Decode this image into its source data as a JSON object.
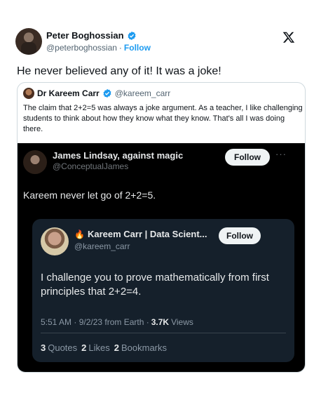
{
  "tweet": {
    "author_name": "Peter Boghossian",
    "author_handle": "@peterboghossian",
    "separator": "·",
    "follow_label": "Follow",
    "text": "He never believed any of it! It was a joke!"
  },
  "quote": {
    "author_name": "Dr Kareem Carr",
    "author_handle": "@kareem_carr",
    "text": "The claim that 2+2=5 was always a joke argument. As a teacher, I like challenging students to think about how they know what they know. That's all I was doing there."
  },
  "screenshot": {
    "author_name": "James Lindsay, against magic",
    "author_handle": "@ConceptualJames",
    "follow_label": "Follow",
    "more": "···",
    "text": "Kareem never let go of 2+2=5.",
    "inner": {
      "author_name": "Kareem Carr | Data Scient...",
      "author_handle": "@kareem_carr",
      "follow_label": "Follow",
      "text": "I challenge you to prove mathematically from first principles that 2+2=4.",
      "timestamp": "5:51 AM · 9/2/23 from Earth ·",
      "views_count": "3.7K",
      "views_label": "Views",
      "quotes_count": "3",
      "quotes_label": "Quotes",
      "likes_count": "2",
      "likes_label": "Likes",
      "bookmarks_count": "2",
      "bookmarks_label": "Bookmarks"
    }
  },
  "colors": {
    "accent": "#1d9bf0",
    "verified": "#1d9bf0",
    "dark_bg": "#000000",
    "inner_bg": "#15202b"
  },
  "icons": [
    "verified-badge-icon",
    "x-logo-icon",
    "fire-icon",
    "more-icon"
  ]
}
